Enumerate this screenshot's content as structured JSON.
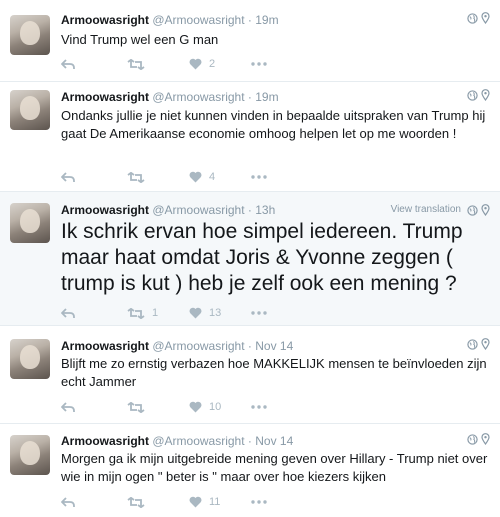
{
  "tweets": [
    {
      "name": "Armoowasright",
      "handle": "@Armoowasright",
      "time": "· 19m",
      "view_translation": "",
      "text": "Vind Trump wel een G man",
      "retweets": "",
      "likes": "2"
    },
    {
      "name": "Armoowasright",
      "handle": "@Armoowasright",
      "time": "· 19m",
      "view_translation": "",
      "text": "Ondanks jullie je niet kunnen vinden in bepaalde uitspraken van Trump hij gaat De Amerikaanse economie omhoog helpen let op me woorden !",
      "retweets": "",
      "likes": "4"
    },
    {
      "name": "Armoowasright",
      "handle": "@Armoowasright",
      "time": "· 13h",
      "view_translation": "View translation",
      "text": "Ik schrik ervan hoe simpel iedereen. Trump maar haat omdat Joris & Yvonne zeggen ( trump is kut ) heb je zelf ook een mening ?",
      "retweets": "1",
      "likes": "13"
    },
    {
      "name": "Armoowasright",
      "handle": "@Armoowasright",
      "time": "· Nov 14",
      "view_translation": "",
      "text": "Blijft me zo ernstig verbazen hoe MAKKELIJK mensen te beïnvloeden zijn echt Jammer",
      "retweets": "",
      "likes": "10"
    },
    {
      "name": "Armoowasright",
      "handle": "@Armoowasright",
      "time": "· Nov 14",
      "view_translation": "",
      "text": "Morgen ga ik mijn uitgebreide mening geven over Hillary - Trump niet over wie in mijn ogen \" beter is \" maar over hoe kiezers kijken",
      "retweets": "",
      "likes": "11"
    }
  ],
  "colors": {
    "name": "#14171a",
    "meta": "#8899a6",
    "action": "#aab8c2",
    "divider": "#e6ecf0"
  },
  "icons": [
    "reply-icon",
    "retweet-icon",
    "like-icon",
    "more-icon",
    "globe-icon",
    "location-pin-icon"
  ]
}
